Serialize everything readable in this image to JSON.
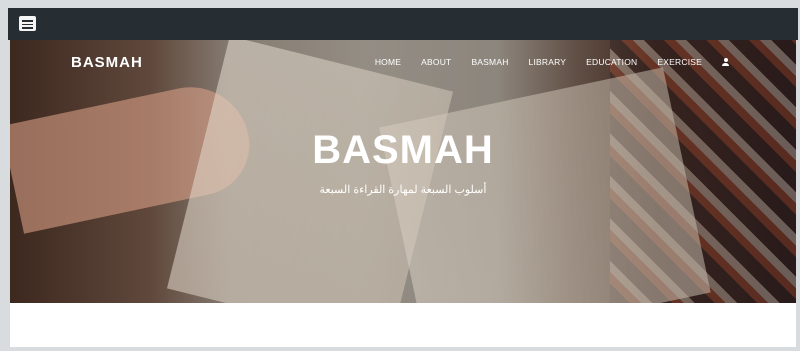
{
  "header": {
    "menu_icon": "hamburger-menu-icon"
  },
  "navbar": {
    "brand": "BASMAH",
    "links": [
      "HOME",
      "ABOUT",
      "BASMAH",
      "LIBRARY",
      "EDUCATION",
      "EXERCISE"
    ],
    "user_icon": "user-icon"
  },
  "hero": {
    "title": "BASMAH",
    "subtitle": "أسلوب السبعة لمهارة القراءة السبعة"
  }
}
